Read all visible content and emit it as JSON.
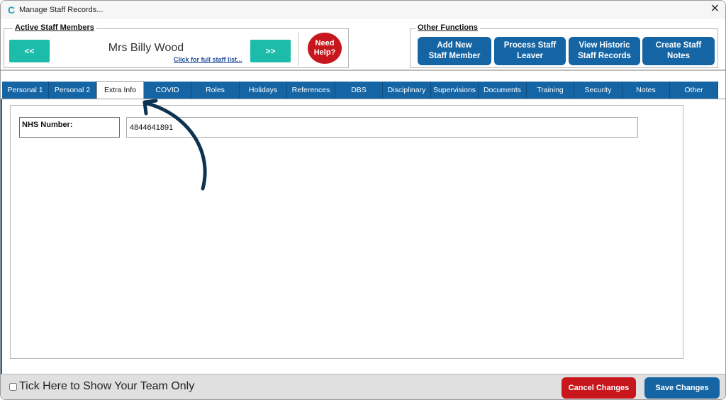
{
  "window": {
    "title": "Manage Staff Records...",
    "app_icon": "C",
    "close_symbol": "✕"
  },
  "active_staff": {
    "group_label": "Active Staff Members",
    "prev_label": "<<",
    "next_label": ">>",
    "staff_name": "Mrs Billy Wood",
    "staff_list_link": "Click for full staff list...",
    "help_label_line1": "Need",
    "help_label_line2": "Help?"
  },
  "other_functions": {
    "group_label": "Other Functions",
    "buttons": [
      {
        "line1": "Add New",
        "line2": "Staff Member"
      },
      {
        "line1": "Process Staff",
        "line2": "Leaver"
      },
      {
        "line1": "View Historic",
        "line2": "Staff Records"
      },
      {
        "line1": "Create Staff",
        "line2": "Notes"
      }
    ]
  },
  "tabs": [
    {
      "label": "Personal 1"
    },
    {
      "label": "Personal 2"
    },
    {
      "label": "Extra Info"
    },
    {
      "label": "COVID"
    },
    {
      "label": "Roles"
    },
    {
      "label": "Holidays"
    },
    {
      "label": "References"
    },
    {
      "label": "DBS"
    },
    {
      "label": "Disciplinary"
    },
    {
      "label": "Supervisions"
    },
    {
      "label": "Documents"
    },
    {
      "label": "Training"
    },
    {
      "label": "Security"
    },
    {
      "label": "Notes"
    },
    {
      "label": "Other"
    }
  ],
  "active_tab": "Extra Info",
  "extra_info": {
    "nhs_label": "NHS Number:",
    "nhs_value": "4844641891"
  },
  "footer": {
    "team_only_label": "Tick Here to Show Your Team Only",
    "team_only_checked": false,
    "cancel_label": "Cancel Changes",
    "save_label": "Save Changes"
  },
  "colors": {
    "teal": "#1dbcaa",
    "blue": "#1565a5",
    "red": "#c8161d",
    "annotation_arrow": "#0d3350"
  },
  "icons": {
    "app": "app-logo-icon",
    "close": "close-icon",
    "annotation": "curved-arrow-icon"
  }
}
